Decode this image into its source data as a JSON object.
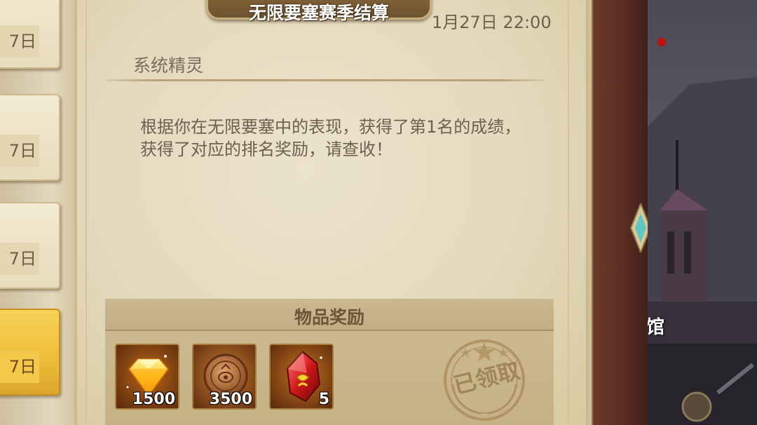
{
  "mail_list": {
    "items": [
      {
        "date_label": "7日",
        "selected": false
      },
      {
        "date_label": "7日",
        "selected": false
      },
      {
        "date_label": "7日",
        "selected": false
      },
      {
        "date_label": "7日",
        "selected": true
      }
    ]
  },
  "mail": {
    "title": "无限要塞赛季结算",
    "time": "1月27日 22:00",
    "sender": "系统精灵",
    "body": "根据你在无限要塞中的表现，获得了第1名的成绩，获得了对应的排名奖励，请查收！"
  },
  "rewards": {
    "header": "物品奖励",
    "items": [
      {
        "icon": "yellow-diamond-icon",
        "count": "1500"
      },
      {
        "icon": "bronze-coin-icon",
        "count": "3500"
      },
      {
        "icon": "red-crystal-icon",
        "count": "5"
      }
    ],
    "claimed_stamp": "已领取"
  },
  "scene": {
    "label": "馆"
  },
  "colors": {
    "parchment": "#e4d9bd",
    "selected_tab": "#eebf3a",
    "banner": "#7a5c34",
    "text": "#6c6052"
  }
}
